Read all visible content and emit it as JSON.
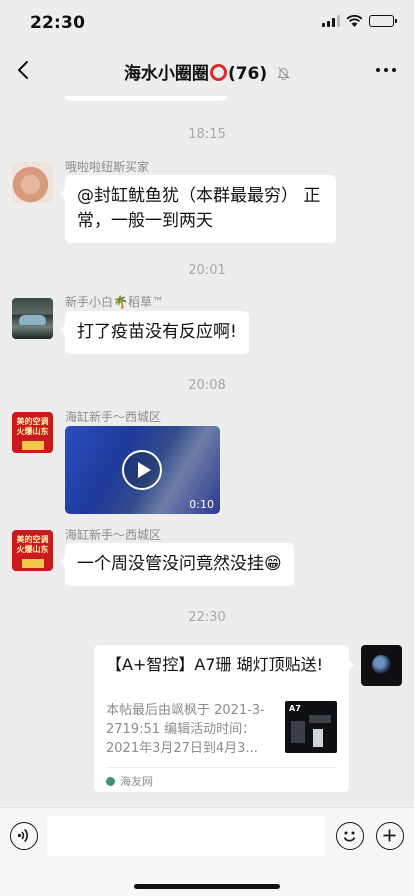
{
  "status_bar": {
    "time": "22:30",
    "battery_level": 0.35
  },
  "nav": {
    "title_prefix": "海水小圈圈",
    "title_suffix": "(76)"
  },
  "messages": {
    "ts1": "18:15",
    "m1_sender": "哦啦啦纽斯买家",
    "m1_text": "@封缸鱿鱼犹（本群最最穷） 正常，一般一到两天",
    "ts2": "20:01",
    "m2_sender": "新手小白🌴稻草™",
    "m2_text": "打了疫苗没有反应啊!",
    "ts3": "20:08",
    "m3_sender": "海缸新手～西城区",
    "m3_video_duration": "0:10",
    "m4_sender": "海缸新手～西城区",
    "m4_text": "一个周没管没问竟然没挂😁",
    "ts4": "22:30",
    "m5_link_title": "【A+智控】A7珊 瑚灯顶贴送!",
    "m5_link_desc": "本帖最后由飒枫于 2021-3-2719:51 编辑活动时间：2021年3月27日到4月3...",
    "m5_link_source": "海友网",
    "m5_thumb_label": "A7"
  },
  "avatar_ad": {
    "line1": "美的空调",
    "line2": "火爆山东"
  },
  "colors": {
    "background": "#ededed",
    "bubble": "#ffffff",
    "ring": "#e0282e"
  }
}
